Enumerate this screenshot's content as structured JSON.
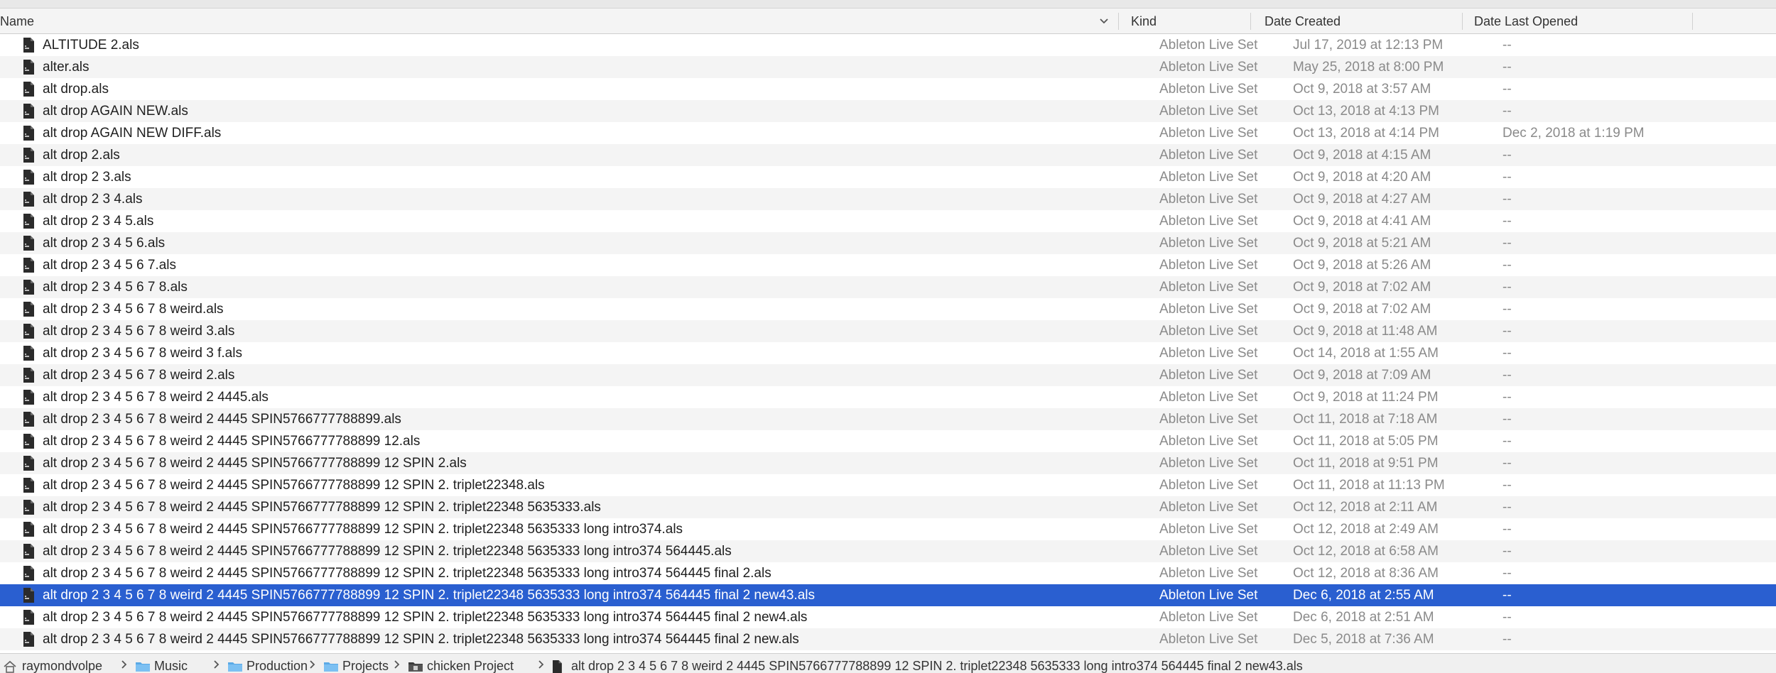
{
  "columns": {
    "name": "Name",
    "kind": "Kind",
    "date_created": "Date Created",
    "date_last_opened": "Date Last Opened"
  },
  "icons": {
    "sort_indicator": "chevron-down-icon",
    "file": "ableton-set-file-icon",
    "home": "home-icon",
    "folder": "folder-icon",
    "path_separator": "chevron-right-icon"
  },
  "colors": {
    "selection": "#2a5fd0",
    "folder": "#5aa9e6",
    "stripe": "#f4f4f4"
  },
  "files": [
    {
      "name": "ALTITUDE 2.als",
      "kind": "Ableton Live Set",
      "created": "Jul 17, 2019 at 12:13 PM",
      "opened": "--"
    },
    {
      "name": "alter.als",
      "kind": "Ableton Live Set",
      "created": "May 25, 2018 at 8:00 PM",
      "opened": "--"
    },
    {
      "name": "alt drop.als",
      "kind": "Ableton Live Set",
      "created": "Oct 9, 2018 at 3:57 AM",
      "opened": "--"
    },
    {
      "name": "alt drop AGAIN NEW.als",
      "kind": "Ableton Live Set",
      "created": "Oct 13, 2018 at 4:13 PM",
      "opened": "--"
    },
    {
      "name": "alt drop AGAIN NEW DIFF.als",
      "kind": "Ableton Live Set",
      "created": "Oct 13, 2018 at 4:14 PM",
      "opened": "Dec 2, 2018 at 1:19 PM"
    },
    {
      "name": "alt drop 2.als",
      "kind": "Ableton Live Set",
      "created": "Oct 9, 2018 at 4:15 AM",
      "opened": "--"
    },
    {
      "name": "alt drop 2 3.als",
      "kind": "Ableton Live Set",
      "created": "Oct 9, 2018 at 4:20 AM",
      "opened": "--"
    },
    {
      "name": "alt drop 2 3 4.als",
      "kind": "Ableton Live Set",
      "created": "Oct 9, 2018 at 4:27 AM",
      "opened": "--"
    },
    {
      "name": "alt drop 2 3 4 5.als",
      "kind": "Ableton Live Set",
      "created": "Oct 9, 2018 at 4:41 AM",
      "opened": "--"
    },
    {
      "name": "alt drop 2 3 4 5 6.als",
      "kind": "Ableton Live Set",
      "created": "Oct 9, 2018 at 5:21 AM",
      "opened": "--"
    },
    {
      "name": "alt drop 2 3 4 5 6 7.als",
      "kind": "Ableton Live Set",
      "created": "Oct 9, 2018 at 5:26 AM",
      "opened": "--"
    },
    {
      "name": "alt drop 2 3 4 5 6 7 8.als",
      "kind": "Ableton Live Set",
      "created": "Oct 9, 2018 at 7:02 AM",
      "opened": "--"
    },
    {
      "name": "alt drop 2 3 4 5 6 7 8 weird.als",
      "kind": "Ableton Live Set",
      "created": "Oct 9, 2018 at 7:02 AM",
      "opened": "--"
    },
    {
      "name": "alt drop 2 3 4 5 6 7 8 weird 3.als",
      "kind": "Ableton Live Set",
      "created": "Oct 9, 2018 at 11:48 AM",
      "opened": "--"
    },
    {
      "name": "alt drop 2 3 4 5 6 7 8 weird 3 f.als",
      "kind": "Ableton Live Set",
      "created": "Oct 14, 2018 at 1:55 AM",
      "opened": "--"
    },
    {
      "name": "alt drop 2 3 4 5 6 7 8 weird 2.als",
      "kind": "Ableton Live Set",
      "created": "Oct 9, 2018 at 7:09 AM",
      "opened": "--"
    },
    {
      "name": "alt drop 2 3 4 5 6 7 8 weird 2 4445.als",
      "kind": "Ableton Live Set",
      "created": "Oct 9, 2018 at 11:24 PM",
      "opened": "--"
    },
    {
      "name": "alt drop 2 3 4 5 6 7 8 weird 2 4445 SPIN5766777788899.als",
      "kind": "Ableton Live Set",
      "created": "Oct 11, 2018 at 7:18 AM",
      "opened": "--"
    },
    {
      "name": "alt drop 2 3 4 5 6 7 8 weird 2 4445 SPIN5766777788899 12.als",
      "kind": "Ableton Live Set",
      "created": "Oct 11, 2018 at 5:05 PM",
      "opened": "--"
    },
    {
      "name": "alt drop 2 3 4 5 6 7 8 weird 2 4445 SPIN5766777788899 12 SPIN 2.als",
      "kind": "Ableton Live Set",
      "created": "Oct 11, 2018 at 9:51 PM",
      "opened": "--"
    },
    {
      "name": "alt drop 2 3 4 5 6 7 8 weird 2 4445 SPIN5766777788899 12 SPIN 2. triplet22348.als",
      "kind": "Ableton Live Set",
      "created": "Oct 11, 2018 at 11:13 PM",
      "opened": "--"
    },
    {
      "name": "alt drop 2 3 4 5 6 7 8 weird 2 4445 SPIN5766777788899 12 SPIN 2. triplet22348 5635333.als",
      "kind": "Ableton Live Set",
      "created": "Oct 12, 2018 at 2:11 AM",
      "opened": "--"
    },
    {
      "name": "alt drop 2 3 4 5 6 7 8 weird 2 4445 SPIN5766777788899 12 SPIN 2. triplet22348 5635333 long intro374.als",
      "kind": "Ableton Live Set",
      "created": "Oct 12, 2018 at 2:49 AM",
      "opened": "--"
    },
    {
      "name": "alt drop 2 3 4 5 6 7 8 weird 2 4445 SPIN5766777788899 12 SPIN 2. triplet22348 5635333 long intro374 564445.als",
      "kind": "Ableton Live Set",
      "created": "Oct 12, 2018 at 6:58 AM",
      "opened": "--"
    },
    {
      "name": "alt drop 2 3 4 5 6 7 8 weird 2 4445 SPIN5766777788899 12 SPIN 2. triplet22348 5635333 long intro374 564445 final 2.als",
      "kind": "Ableton Live Set",
      "created": "Oct 12, 2018 at 8:36 AM",
      "opened": "--"
    },
    {
      "name": "alt drop 2 3 4 5 6 7 8 weird 2 4445 SPIN5766777788899 12 SPIN 2. triplet22348 5635333 long intro374 564445 final 2 new43.als",
      "kind": "Ableton Live Set",
      "created": "Dec 6, 2018 at 2:55 AM",
      "opened": "--",
      "selected": true
    },
    {
      "name": "alt drop 2 3 4 5 6 7 8 weird 2 4445 SPIN5766777788899 12 SPIN 2. triplet22348 5635333 long intro374 564445 final 2 new4.als",
      "kind": "Ableton Live Set",
      "created": "Dec 6, 2018 at 2:51 AM",
      "opened": "--"
    },
    {
      "name": "alt drop 2 3 4 5 6 7 8 weird 2 4445 SPIN5766777788899 12 SPIN 2. triplet22348 5635333 long intro374 564445 final 2 new.als",
      "kind": "Ableton Live Set",
      "created": "Dec 5, 2018 at 7:36 AM",
      "opened": "--"
    }
  ],
  "path": [
    {
      "label": "raymondvolpe",
      "icon": "home-icon"
    },
    {
      "label": "Music",
      "icon": "folder-icon"
    },
    {
      "label": "Production",
      "icon": "folder-icon"
    },
    {
      "label": "Projects",
      "icon": "folder-icon"
    },
    {
      "label": "chicken Project",
      "icon": "project-folder-icon"
    },
    {
      "label": "alt drop 2 3 4 5 6 7 8 weird 2 4445 SPIN5766777788899 12 SPIN 2. triplet22348 5635333 long intro374 564445 final 2 new43.als",
      "icon": "ableton-set-file-icon"
    }
  ]
}
